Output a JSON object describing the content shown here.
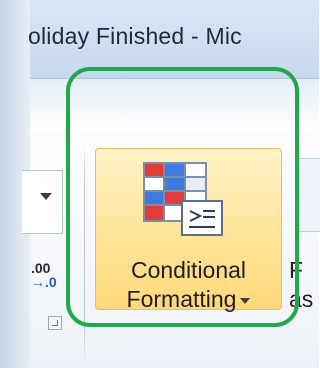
{
  "window": {
    "title": "oliday Finished  -  Mic"
  },
  "number_group": {
    "decrease_decimal_top": ".00",
    "decrease_decimal_bottom": "→.0"
  },
  "styles_group": {
    "conditional_formatting": {
      "line1": "Conditional",
      "line2": "Formatting"
    },
    "next_button": {
      "line1": "F",
      "line2": "as"
    }
  },
  "icons": {
    "conditional_formatting": "conditional-formatting-icon",
    "dropdown": "chevron-down-icon",
    "decimal": "decrease-decimal-icon",
    "launcher": "dialog-launcher-icon"
  },
  "colors": {
    "highlight": "#22a84a",
    "button_hover": "#ffe6a0",
    "ribbon_blue": "#cfdff1"
  }
}
